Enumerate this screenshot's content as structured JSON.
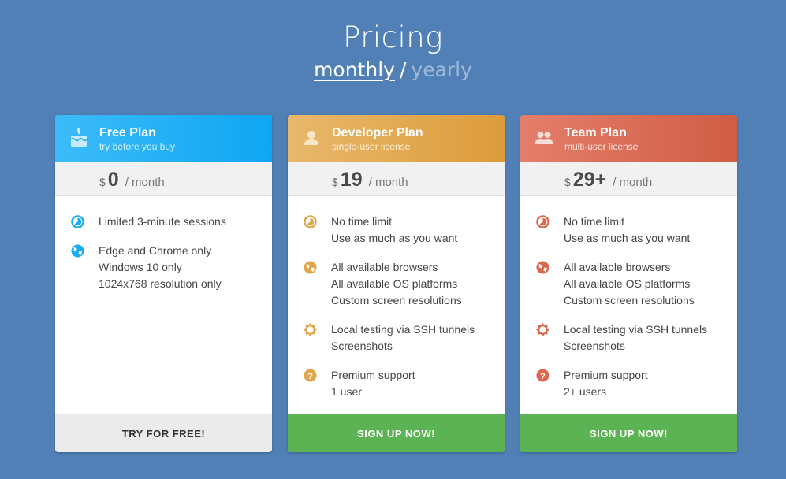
{
  "header": {
    "title": "Pricing",
    "period_active": "monthly",
    "period_separator": "/",
    "period_inactive": "yearly"
  },
  "colors": {
    "background": "#5180b6",
    "free": "#1aabf5",
    "developer": "#e0a64a",
    "team": "#d9684f",
    "cta_green": "#5cb354"
  },
  "plans": [
    {
      "name": "Free Plan",
      "subtitle": "try before you buy",
      "icon": "cake-icon",
      "currency": "$",
      "amount": "0",
      "period": "/ month",
      "features": [
        {
          "icon": "clock-icon",
          "lines": [
            "Limited 3-minute sessions"
          ]
        },
        {
          "icon": "globe-icon",
          "lines": [
            "Edge and Chrome only",
            "Windows 10 only",
            "1024x768 resolution only"
          ]
        }
      ],
      "cta": "TRY FOR FREE!"
    },
    {
      "name": "Developer Plan",
      "subtitle": "single-user license",
      "icon": "user-icon",
      "currency": "$",
      "amount": "19",
      "period": "/ month",
      "features": [
        {
          "icon": "clock-icon",
          "lines": [
            "No time limit",
            "Use as much as you want"
          ]
        },
        {
          "icon": "globe-icon",
          "lines": [
            "All available browsers",
            "All available OS platforms",
            "Custom screen resolutions"
          ]
        },
        {
          "icon": "gear-icon",
          "lines": [
            "Local testing via SSH tunnels",
            "Screenshots"
          ]
        },
        {
          "icon": "help-icon",
          "lines": [
            "Premium support",
            "1 user"
          ]
        }
      ],
      "cta": "SIGN UP NOW!"
    },
    {
      "name": "Team Plan",
      "subtitle": "multi-user license",
      "icon": "users-icon",
      "currency": "$",
      "amount": "29+",
      "period": "/ month",
      "features": [
        {
          "icon": "clock-icon",
          "lines": [
            "No time limit",
            "Use as much as you want"
          ]
        },
        {
          "icon": "globe-icon",
          "lines": [
            "All available browsers",
            "All available OS platforms",
            "Custom screen resolutions"
          ]
        },
        {
          "icon": "gear-icon",
          "lines": [
            "Local testing via SSH tunnels",
            "Screenshots"
          ]
        },
        {
          "icon": "help-icon",
          "lines": [
            "Premium support",
            "2+ users"
          ]
        }
      ],
      "cta": "SIGN UP NOW!"
    }
  ]
}
